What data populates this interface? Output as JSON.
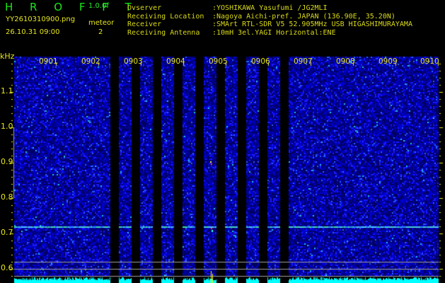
{
  "header": {
    "app_name": "H R O F F T",
    "version": "1.0.0f",
    "filename": "YY2610310900.png",
    "datetime": "26.10.31 09:00",
    "meteor_label": "meteor",
    "meteor_count": "2"
  },
  "info": [
    {
      "key": "Ovserver",
      "value": ":YOSHIKAWA Yasufumi /JG2MLI"
    },
    {
      "key": "Receiving Location",
      "value": ":Nagoya Aichi-pref. JAPAN (136.90E, 35.20N)"
    },
    {
      "key": "Receiver",
      "value": ":SMArt RTL-SDR V5 52.905MHz USB HIGASHIMURAYAMA"
    },
    {
      "key": "Receiving Antenna",
      "value": ":10mH 3el.YAGI Horizontal:ENE"
    }
  ],
  "spectrogram": {
    "y_unit": "kHz",
    "y_ticks": [
      "1.1",
      "1.0",
      "0.9",
      "0.8",
      "0.7",
      "0.6"
    ],
    "time_labels": [
      "0901",
      "0902",
      "0903",
      "0904",
      "0905",
      "0906",
      "0907",
      "0908",
      "0909",
      "0910"
    ],
    "colors": {
      "text": "#e6e61e",
      "background_noise": "#0000c8",
      "level_bar": "#00ffff",
      "grid": "#a0a0a0"
    }
  }
}
